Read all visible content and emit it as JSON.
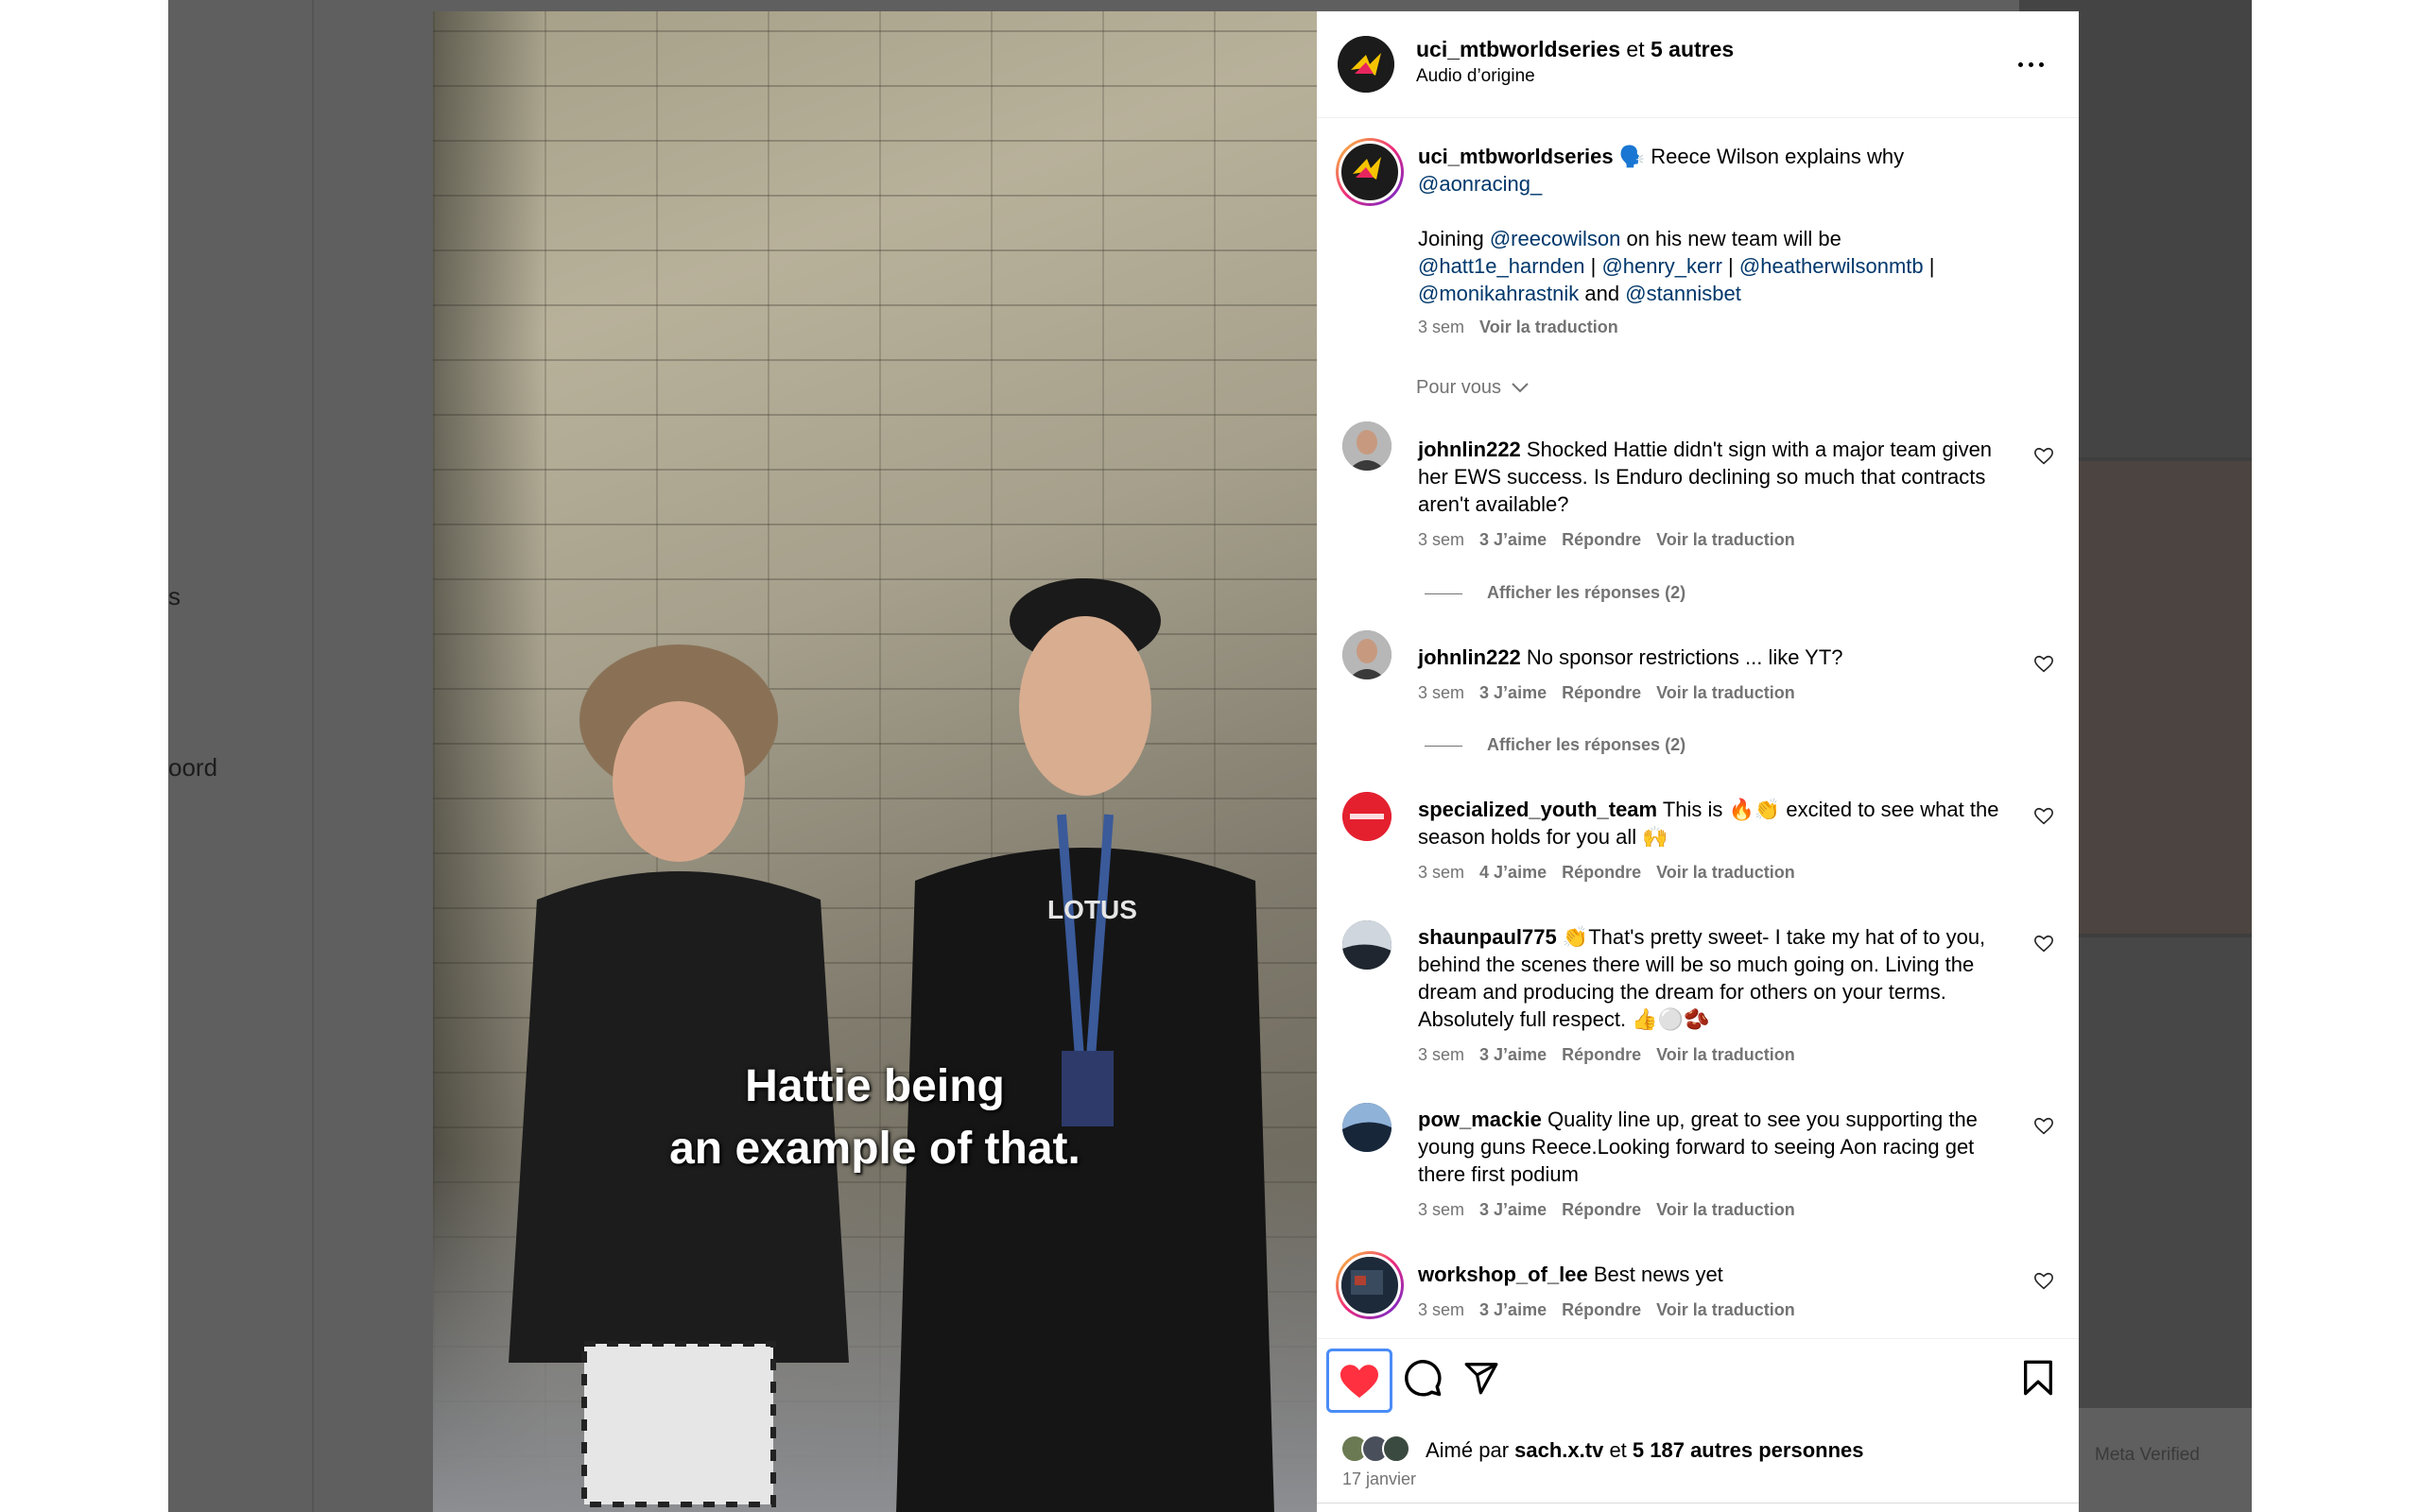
{
  "background": {
    "left_fragments": [
      "s",
      "oord"
    ],
    "meta_verified": "Meta Verified"
  },
  "video": {
    "caption_line1": "Hattie being",
    "caption_line2": "an example of that."
  },
  "header": {
    "username": "uci_mtbworldseries",
    "joiner": " et ",
    "others": "5 autres",
    "audio": "Audio d’origine"
  },
  "caption": {
    "username": "uci_mtbworldseries",
    "emoji": "🗣️",
    "text1": " Reece Wilson explains why ",
    "mention1": "@aonracing_",
    "joining": "Joining ",
    "mention2": "@reecowilson",
    "text2": " on his new team will be",
    "mention3": "@hatt1e_harnden",
    "sep": " | ",
    "mention4": "@henry_kerr",
    "mention5": "@heatherwilsonmtb",
    "mention6": "@monikahrastnik",
    "and": " and ",
    "mention7": "@stannisbet",
    "time": "3 sem",
    "translate": "Voir la traduction"
  },
  "sort_label": "Pour vous",
  "comments": [
    {
      "user": "johnlin222",
      "text": "Shocked Hattie didn't sign with a major team given her EWS success. Is Enduro declining so much that contracts aren't available?",
      "time": "3 sem",
      "likes": "3 J’aime",
      "reply": "Répondre",
      "translate": "Voir la traduction",
      "replies": "Afficher les réponses (2)"
    },
    {
      "user": "johnlin222",
      "text": "No sponsor restrictions ... like YT?",
      "time": "3 sem",
      "likes": "3 J’aime",
      "reply": "Répondre",
      "translate": "Voir la traduction",
      "replies": "Afficher les réponses (2)"
    },
    {
      "user": "specialized_youth_team",
      "text": "This is 🔥👏 excited to see what the season holds for you all 🙌",
      "time": "3 sem",
      "likes": "4 J’aime",
      "reply": "Répondre",
      "translate": "Voir la traduction"
    },
    {
      "user": "shaunpaul775",
      "text": "👏That's pretty sweet- I take my hat of to you, behind the scenes there will be so much going on. Living the dream and producing the dream for others on your terms. Absolutely full respect. 👍⚪🫘",
      "time": "3 sem",
      "likes": "3 J’aime",
      "reply": "Répondre",
      "translate": "Voir la traduction"
    },
    {
      "user": "pow_mackie",
      "text": "Quality line up, great to see you supporting the young guns Reece.Looking forward to seeing Aon racing get there first podium",
      "time": "3 sem",
      "likes": "3 J’aime",
      "reply": "Répondre",
      "translate": "Voir la traduction"
    },
    {
      "user": "workshop_of_lee",
      "text": "Best news yet",
      "time": "3 sem",
      "likes": "3 J’aime",
      "reply": "Répondre",
      "translate": "Voir la traduction"
    }
  ],
  "likes": {
    "prefix": "Aimé par ",
    "user": "sach.x.tv",
    "joiner": " et ",
    "others": "5 187 autres personnes",
    "date": "17 janvier"
  },
  "colors": {
    "like_red": "#ff3040",
    "link_blue": "#00376b",
    "muted_gray": "#737373"
  },
  "icons": [
    "more-icon",
    "heart-icon",
    "comment-icon",
    "share-icon",
    "bookmark-icon",
    "chevron-down-icon",
    "reel-icon"
  ]
}
